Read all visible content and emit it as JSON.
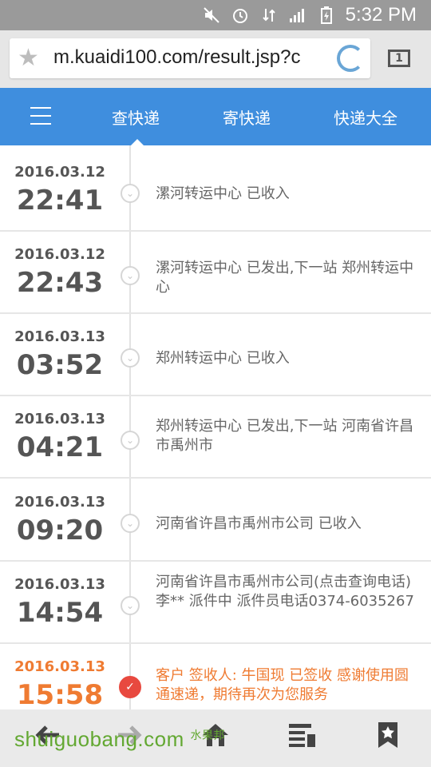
{
  "status_bar": {
    "time": "5:32 PM"
  },
  "browser": {
    "url": "m.kuaidi100.com/result.jsp?c"
  },
  "nav": {
    "tabs": [
      "查快递",
      "寄快递",
      "快递大全"
    ]
  },
  "timeline": [
    {
      "date": "2016.03.12",
      "time": "22:41",
      "desc": "漯河转运中心 已收入"
    },
    {
      "date": "2016.03.12",
      "time": "22:43",
      "desc": "漯河转运中心 已发出,下一站 郑州转运中心"
    },
    {
      "date": "2016.03.13",
      "time": "03:52",
      "desc": "郑州转运中心 已收入"
    },
    {
      "date": "2016.03.13",
      "time": "04:21",
      "desc": "郑州转运中心 已发出,下一站 河南省许昌市禹州市"
    },
    {
      "date": "2016.03.13",
      "time": "09:20",
      "desc": "河南省许昌市禹州市公司 已收入"
    },
    {
      "date": "2016.03.13",
      "time": "14:54",
      "desc": "河南省许昌市禹州市公司(点击查询电话)李** 派件中 派件员电话0374-6035267"
    },
    {
      "date": "2016.03.13",
      "time": "15:58",
      "desc": "客户 签收人: 牛国现 已签收 感谢使用圆通速递，期待再次为您服务"
    }
  ],
  "watermark": {
    "text": "shuiguobang.com",
    "cn": "水果邦"
  },
  "colors": {
    "nav": "#3f8ede",
    "accent": "#ef7b32",
    "check": "#e8493f"
  }
}
